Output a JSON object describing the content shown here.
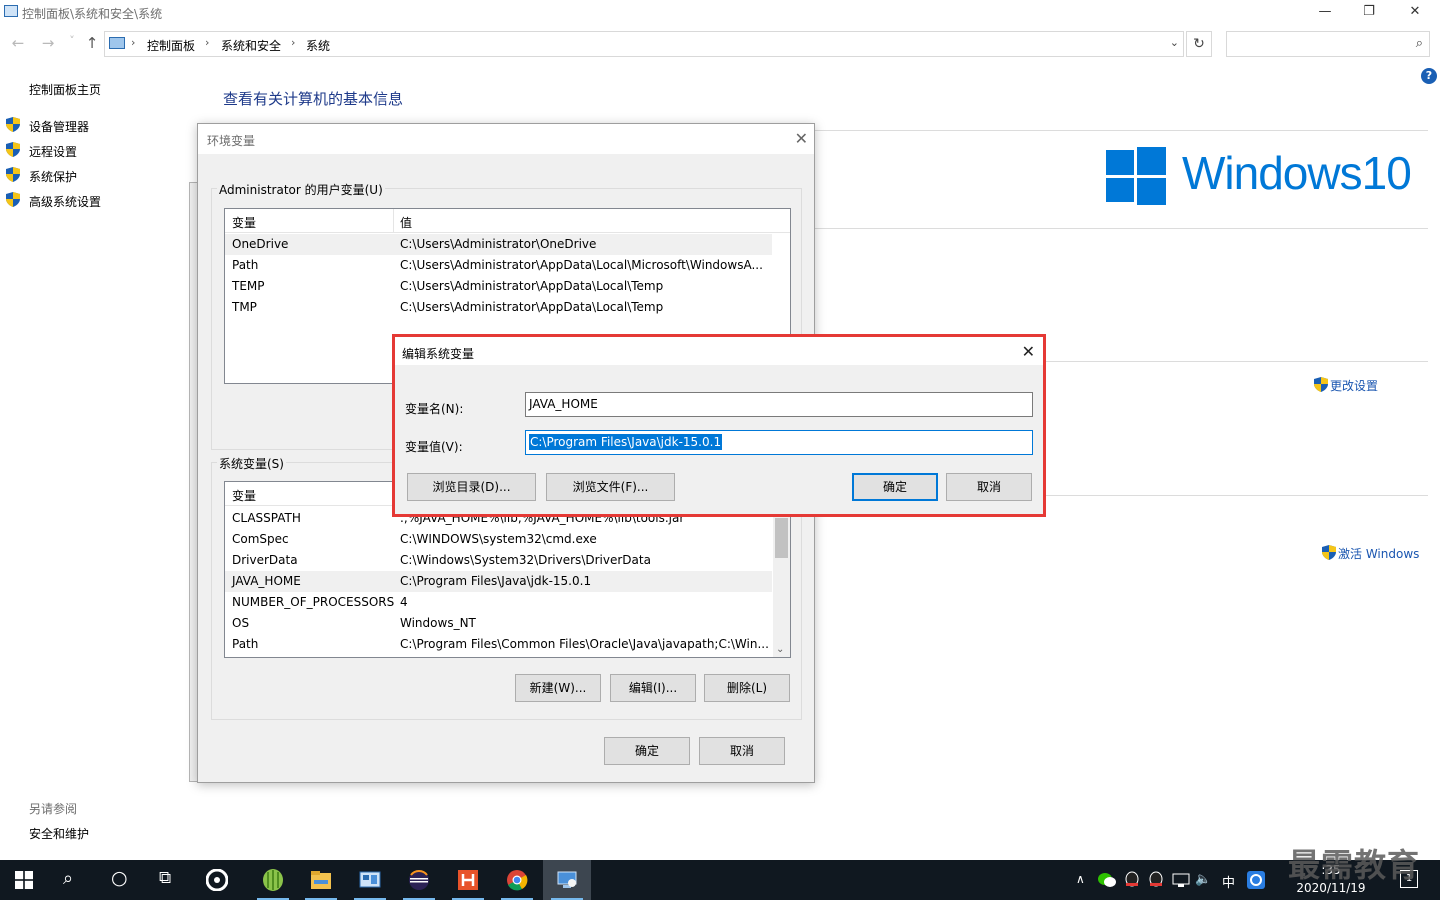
{
  "window": {
    "title": "控制面板\\系统和安全\\系统",
    "minimize_glyph": "—",
    "restore_glyph": "❐",
    "close_glyph": "✕"
  },
  "nav": {
    "back_glyph": "←",
    "forward_glyph": "→",
    "recent_glyph": "˅",
    "up_glyph": "↑",
    "breadcrumbs": [
      "控制面板",
      "系统和安全",
      "系统"
    ],
    "sep_glyph": "›",
    "dropdown_glyph": "⌄",
    "refresh_glyph": "↻",
    "search_placeholder": "",
    "search_glyph": "⌕"
  },
  "sidebar": {
    "home": "控制面板主页",
    "items": [
      {
        "label": "设备管理器"
      },
      {
        "label": "远程设置"
      },
      {
        "label": "系统保护"
      },
      {
        "label": "高级系统设置"
      }
    ],
    "see_also": "另请参阅",
    "security": "安全和维护"
  },
  "main": {
    "heading": "查看有关计算机的基本信息",
    "help_glyph": "?",
    "windows_text": "Windows10",
    "change_settings": "更改设置",
    "activate": "激活 Windows"
  },
  "env_dialog": {
    "title": "环境变量",
    "close_glyph": "✕",
    "user_group_label": "Administrator 的用户变量(U)",
    "sys_group_label": "系统变量(S)",
    "col_var": "变量",
    "col_val": "值",
    "user_vars": [
      {
        "name": "OneDrive",
        "value": "C:\\Users\\Administrator\\OneDrive"
      },
      {
        "name": "Path",
        "value": "C:\\Users\\Administrator\\AppData\\Local\\Microsoft\\WindowsA..."
      },
      {
        "name": "TEMP",
        "value": "C:\\Users\\Administrator\\AppData\\Local\\Temp"
      },
      {
        "name": "TMP",
        "value": "C:\\Users\\Administrator\\AppData\\Local\\Temp"
      }
    ],
    "sys_vars": [
      {
        "name": "CLASSPATH",
        "value": ".;%JAVA_HOME%\\lib;%JAVA_HOME%\\lib\\tools.jar"
      },
      {
        "name": "ComSpec",
        "value": "C:\\WINDOWS\\system32\\cmd.exe"
      },
      {
        "name": "DriverData",
        "value": "C:\\Windows\\System32\\Drivers\\DriverData"
      },
      {
        "name": "JAVA_HOME",
        "value": "C:\\Program Files\\Java\\jdk-15.0.1"
      },
      {
        "name": "NUMBER_OF_PROCESSORS",
        "value": "4"
      },
      {
        "name": "OS",
        "value": "Windows_NT"
      },
      {
        "name": "Path",
        "value": "C:\\Program Files\\Common Files\\Oracle\\Java\\javapath;C:\\Win..."
      }
    ],
    "btn_new": "新建(W)...",
    "btn_edit": "编辑(I)...",
    "btn_delete": "删除(L)",
    "btn_ok": "确定",
    "btn_cancel": "取消",
    "scroll_down_glyph": "⌄"
  },
  "edit_dialog": {
    "title": "编辑系统变量",
    "close_glyph": "✕",
    "name_label": "变量名(N):",
    "name_value": "JAVA_HOME",
    "value_label": "变量值(V):",
    "value_value": "C:\\Program Files\\Java\\jdk-15.0.1",
    "btn_browse_dir": "浏览目录(D)...",
    "btn_browse_file": "浏览文件(F)...",
    "btn_ok": "确定",
    "btn_cancel": "取消"
  },
  "taskbar": {
    "search_glyph": "⌕",
    "cortana_glyph": "○",
    "taskview_glyph": "⧉",
    "tray_chevron": "∧",
    "speaker_glyph": "🔈",
    "ime": "中",
    "clock_time": ":35",
    "clock_date": "2020/11/19",
    "notification_count": "1"
  },
  "watermark": "最需教育",
  "colors": {
    "accent": "#0078d7",
    "highlight_border": "#e53935",
    "taskbar": "#101820"
  }
}
